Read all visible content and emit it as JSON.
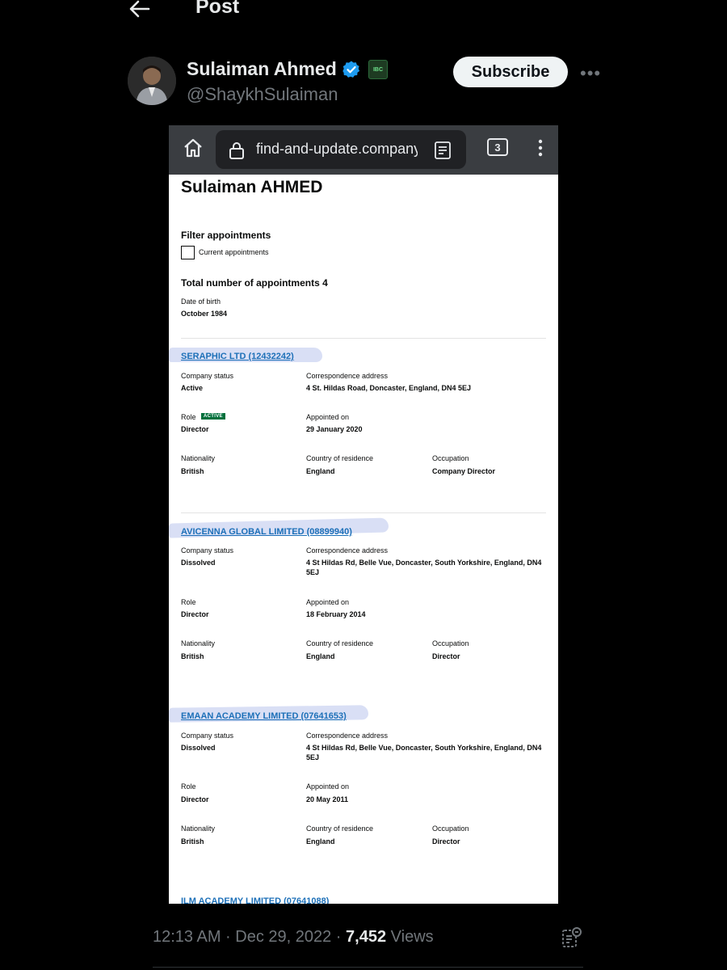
{
  "header": {
    "title": "Post"
  },
  "author": {
    "name": "Sulaiman Ahmed",
    "handle": "@ShaykhSulaiman",
    "badge_text": "IBC",
    "subscribe_label": "Subscribe",
    "more_label": "•••"
  },
  "browser": {
    "url": "find-and-update.company",
    "tab_count": "3"
  },
  "page": {
    "officer_name": "Sulaiman AHMED",
    "filter_heading": "Filter appointments",
    "filter_checkbox_label": "Current appointments",
    "total_appointments": "Total number of appointments 4",
    "dob_label": "Date of birth",
    "dob_value": "October 1984",
    "labels": {
      "status": "Company status",
      "address": "Correspondence address",
      "role": "Role",
      "appointed": "Appointed on",
      "nationality": "Nationality",
      "residence": "Country of residence",
      "occupation": "Occupation"
    },
    "active_tag": "ACTIVE",
    "appointments": [
      {
        "company": "SERAPHIC LTD (12432242)",
        "status": "Active",
        "address": "4 St. Hildas Road, Doncaster, England, DN4 5EJ",
        "role": "Director",
        "appointed": "29 January 2020",
        "nationality": "British",
        "residence": "England",
        "occupation": "Company Director"
      },
      {
        "company": "AVICENNA GLOBAL LIMITED (08899940)",
        "status": "Dissolved",
        "address": "4 St Hildas Rd, Belle Vue, Doncaster, South Yorkshire, England, DN4 5EJ",
        "role": "Director",
        "appointed": "18 February 2014",
        "nationality": "British",
        "residence": "England",
        "occupation": "Director"
      },
      {
        "company": "EMAAN ACADEMY LIMITED (07641653)",
        "status": "Dissolved",
        "address": "4 St Hildas Rd, Belle Vue, Doncaster, South Yorkshire, England, DN4 5EJ",
        "role": "Director",
        "appointed": "20 May 2011",
        "nationality": "British",
        "residence": "England",
        "occupation": "Director"
      },
      {
        "company": "ILM ACADEMY LIMITED (07641088)"
      }
    ]
  },
  "footer": {
    "time": "12:13 AM · Dec 29, 2022 · ",
    "views_count": "7,452",
    "views_label": " Views"
  },
  "colors": {
    "link": "#1d70b8",
    "active_tag": "#00703c",
    "verified": "#1d9bf0"
  }
}
